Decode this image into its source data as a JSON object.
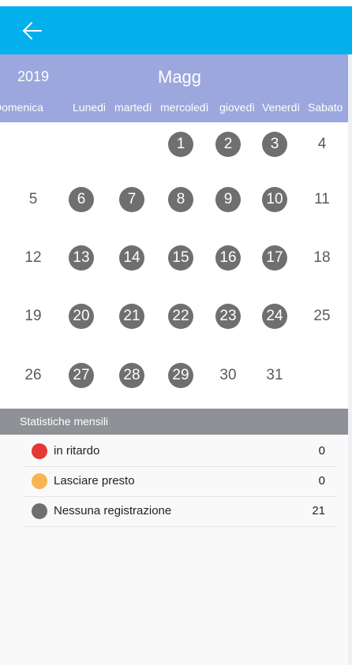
{
  "header": {
    "back_icon": "arrow-left-icon",
    "year": "2019",
    "month": "Magg"
  },
  "weekdays": [
    "Domenica",
    "Lunedi",
    "martedì",
    "mercoledì",
    "giovedì",
    "Venerdì",
    "Sabato"
  ],
  "calendar": {
    "weeks": [
      [
        {
          "day": "",
          "marked": false
        },
        {
          "day": "",
          "marked": false
        },
        {
          "day": "",
          "marked": false
        },
        {
          "day": "1",
          "marked": true
        },
        {
          "day": "2",
          "marked": true
        },
        {
          "day": "3",
          "marked": true
        },
        {
          "day": "4",
          "marked": false
        }
      ],
      [
        {
          "day": "5",
          "marked": false
        },
        {
          "day": "6",
          "marked": true
        },
        {
          "day": "7",
          "marked": true
        },
        {
          "day": "8",
          "marked": true
        },
        {
          "day": "9",
          "marked": true
        },
        {
          "day": "10",
          "marked": true
        },
        {
          "day": "11",
          "marked": false
        }
      ],
      [
        {
          "day": "12",
          "marked": false
        },
        {
          "day": "13",
          "marked": true
        },
        {
          "day": "14",
          "marked": true
        },
        {
          "day": "15",
          "marked": true
        },
        {
          "day": "16",
          "marked": true
        },
        {
          "day": "17",
          "marked": true
        },
        {
          "day": "18",
          "marked": false
        }
      ],
      [
        {
          "day": "19",
          "marked": false
        },
        {
          "day": "20",
          "marked": true
        },
        {
          "day": "21",
          "marked": true
        },
        {
          "day": "22",
          "marked": true
        },
        {
          "day": "23",
          "marked": true
        },
        {
          "day": "24",
          "marked": true
        },
        {
          "day": "25",
          "marked": false
        }
      ],
      [
        {
          "day": "26",
          "marked": false
        },
        {
          "day": "27",
          "marked": true
        },
        {
          "day": "28",
          "marked": true
        },
        {
          "day": "29",
          "marked": true
        },
        {
          "day": "30",
          "marked": false
        },
        {
          "day": "31",
          "marked": false
        },
        {
          "day": "",
          "marked": false
        }
      ]
    ]
  },
  "stats": {
    "title": "Statistiche mensili",
    "rows": [
      {
        "label": "in ritardo",
        "value": "0",
        "color": "#e53935"
      },
      {
        "label": "Lasciare presto",
        "value": "0",
        "color": "#f6b453"
      },
      {
        "label": "Nessuna registrazione",
        "value": "21",
        "color": "#6f6f6f"
      }
    ]
  },
  "colors": {
    "topbar": "#03b0ec",
    "monthbar": "#9ba7dd",
    "marked_day": "#6f6f6f",
    "stats_header": "#8f9196"
  }
}
